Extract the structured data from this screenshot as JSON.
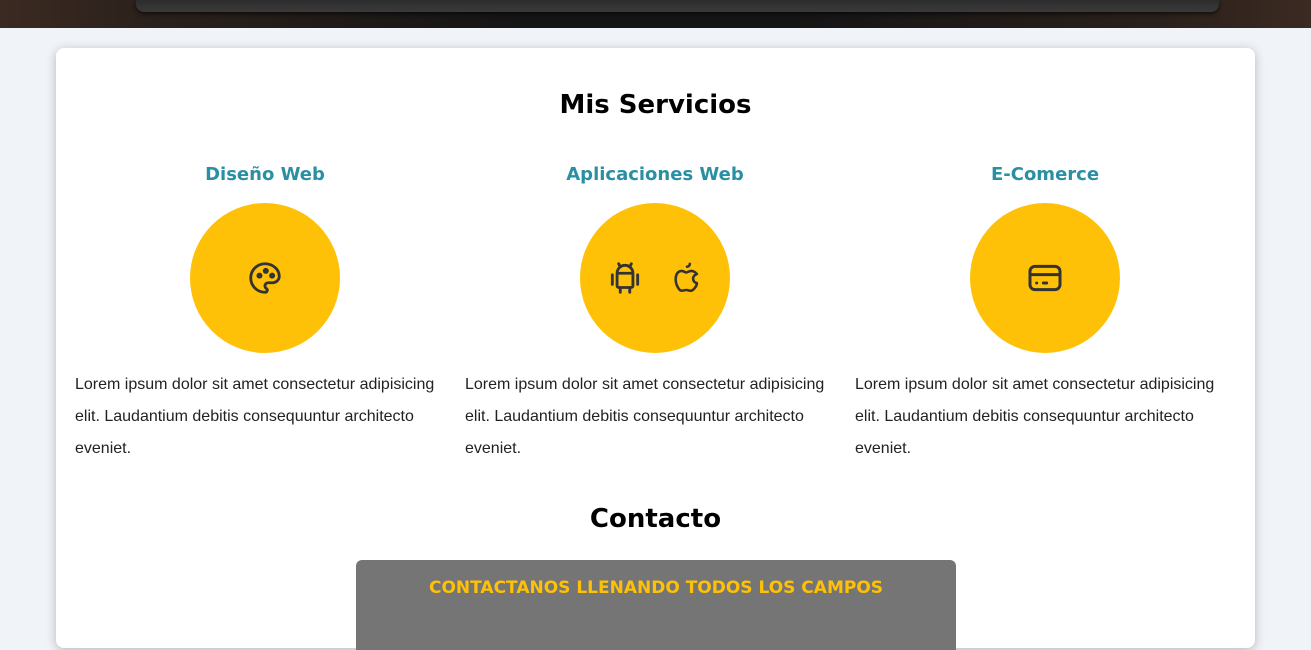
{
  "services": {
    "title": "Mis Servicios",
    "items": [
      {
        "name": "Diseño Web",
        "icons": [
          "palette-icon"
        ],
        "description": "Lorem ipsum dolor sit amet consectetur adipisicing elit. Laudantium debitis consequuntur architecto eveniet."
      },
      {
        "name": "Aplicaciones Web",
        "icons": [
          "android-icon",
          "apple-icon"
        ],
        "description": "Lorem ipsum dolor sit amet consectetur adipisicing elit. Laudantium debitis consequuntur architecto eveniet."
      },
      {
        "name": "E-Comerce",
        "icons": [
          "credit-card-icon"
        ],
        "description": "Lorem ipsum dolor sit amet consectetur adipisicing elit. Laudantium debitis consequuntur architecto eveniet."
      }
    ]
  },
  "contact": {
    "title": "Contacto",
    "form_heading": "CONTACTANOS LLENANDO TODOS LOS CAMPOS"
  },
  "colors": {
    "accent": "#ffc107",
    "service_title": "#2b8fa3",
    "form_background": "#757575",
    "page_background": "#f0f3f8"
  }
}
